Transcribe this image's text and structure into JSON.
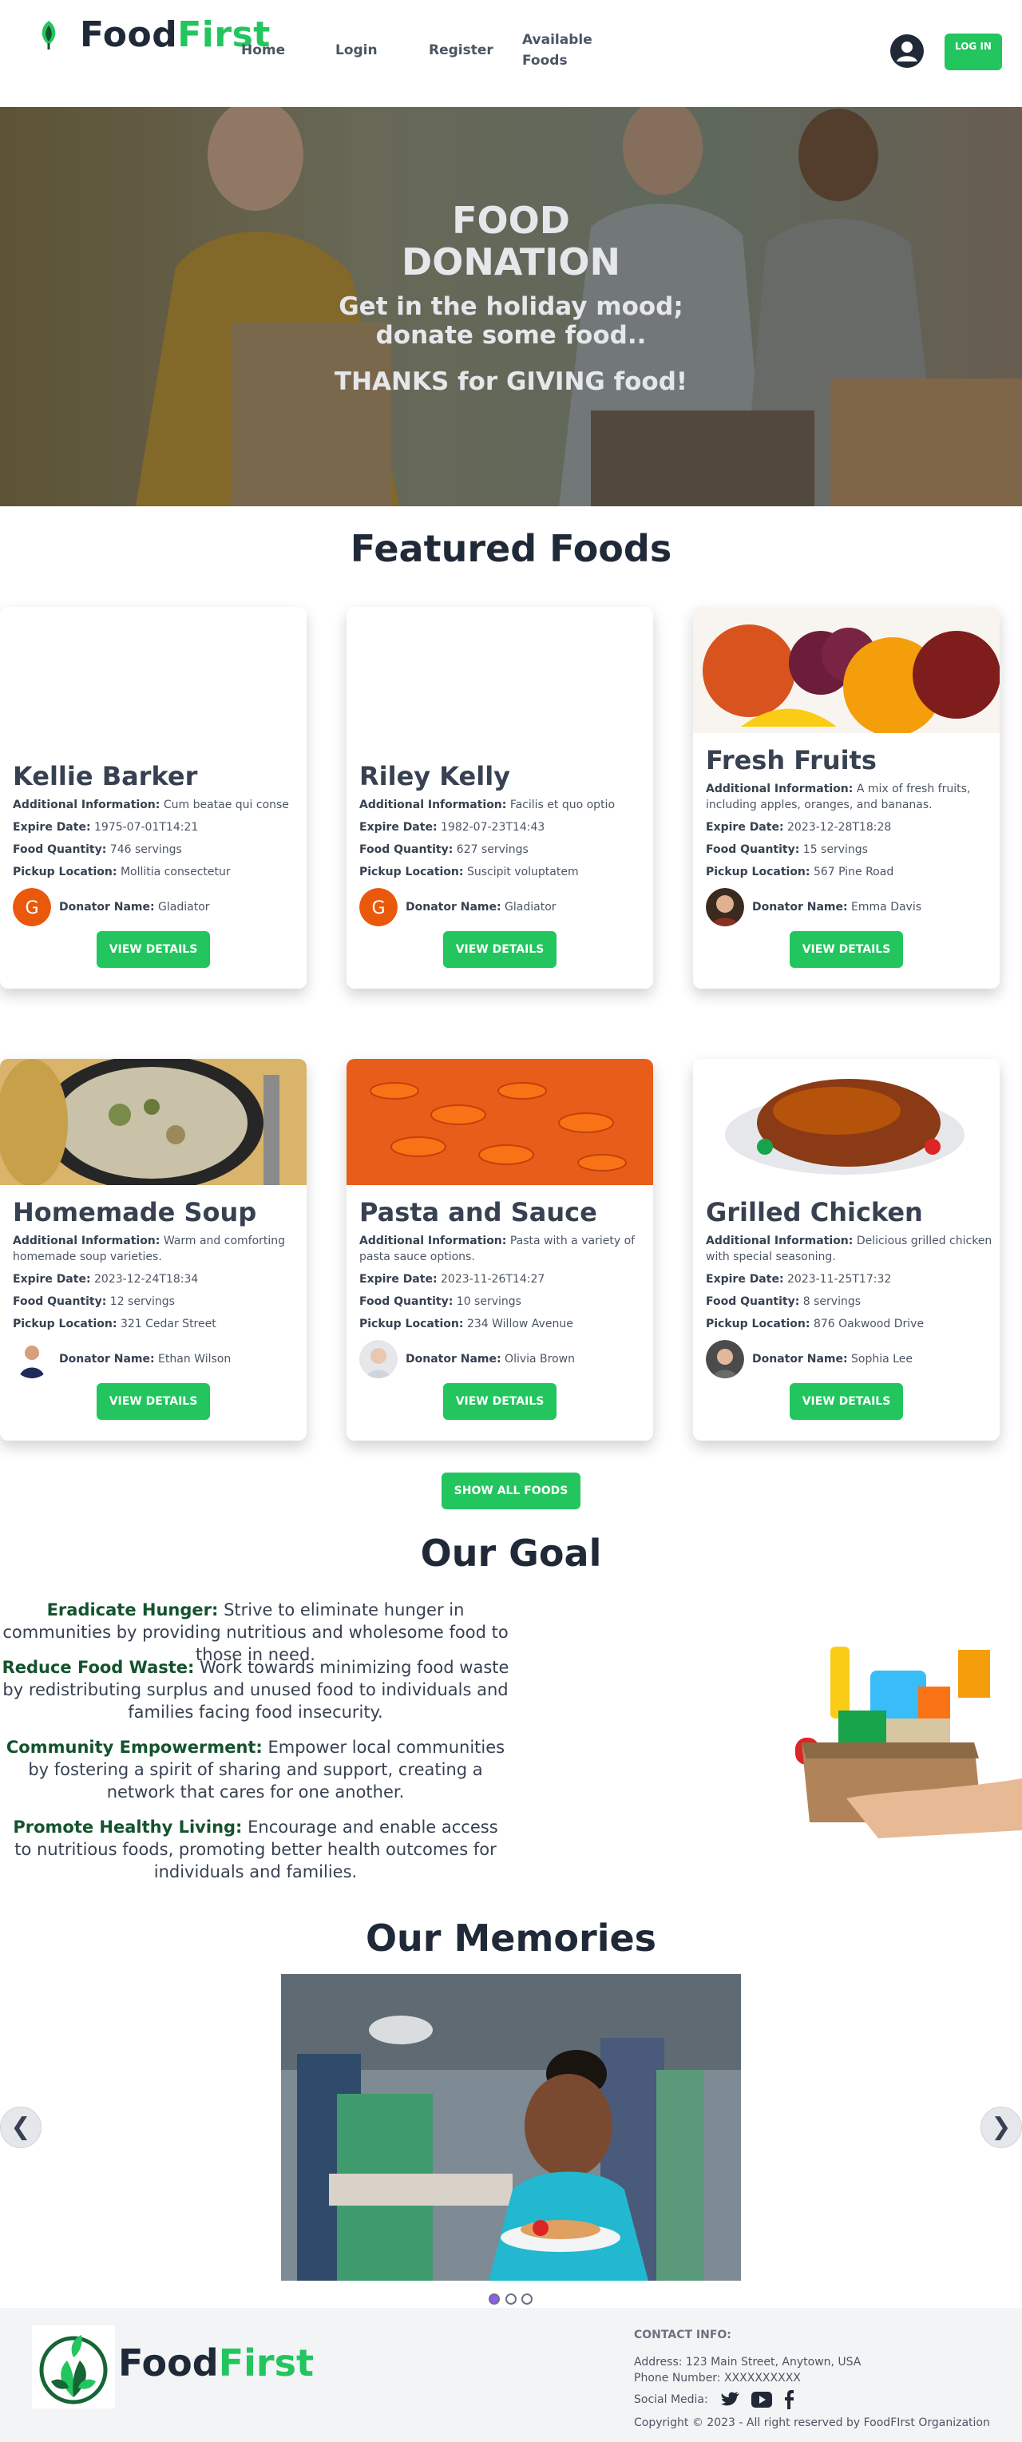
{
  "brand": {
    "name_a": "Food",
    "name_b": "First",
    "accent": "#22c55e"
  },
  "nav": {
    "links": [
      "Home",
      "Login",
      "Register",
      "Available Foods"
    ],
    "login_button": "LOG IN"
  },
  "hero": {
    "title": "FOOD DONATION",
    "subtitle": "Get in the holiday mood; donate some food..",
    "thanks": "THANKS for GIVING food!"
  },
  "featured": {
    "title": "Featured Foods",
    "labels": {
      "info": "Additional Information:",
      "expire": "Expire Date:",
      "quantity": "Food Quantity:",
      "location": "Pickup Location:",
      "donator": "Donator Name:"
    },
    "view_button": "VIEW DETAILS",
    "cards": [
      {
        "name": "Kellie Barker",
        "info": "Cum beatae qui conse",
        "expire": "1975-07-01T14:21",
        "quantity": "746 servings",
        "location": "Mollitia consectetur",
        "donator": "Gladiator",
        "avatar_letter": "G"
      },
      {
        "name": "Riley Kelly",
        "info": "Facilis et quo optio",
        "expire": "1982-07-23T14:43",
        "quantity": "627 servings",
        "location": "Suscipit voluptatem",
        "donator": "Gladiator",
        "avatar_letter": "G"
      },
      {
        "name": "Fresh Fruits",
        "info": "A mix of fresh fruits, including apples, oranges, and bananas.",
        "expire": "2023-12-28T18:28",
        "quantity": "15 servings",
        "location": "567 Pine Road",
        "donator": "Emma Davis"
      },
      {
        "name": "Homemade Soup",
        "info": "Warm and comforting homemade soup varieties.",
        "expire": "2023-12-24T18:34",
        "quantity": "12 servings",
        "location": "321 Cedar Street",
        "donator": "Ethan Wilson"
      },
      {
        "name": "Pasta and Sauce",
        "info": "Pasta with a variety of pasta sauce options.",
        "expire": "2023-11-26T14:27",
        "quantity": "10 servings",
        "location": "234 Willow Avenue",
        "donator": "Olivia Brown"
      },
      {
        "name": "Grilled Chicken",
        "info": "Delicious grilled chicken with special seasoning.",
        "expire": "2023-11-25T17:32",
        "quantity": "8 servings",
        "location": "876 Oakwood Drive",
        "donator": "Sophia Lee"
      }
    ],
    "show_all": "SHOW ALL FOODS"
  },
  "goals": {
    "title": "Our Goal",
    "items": [
      {
        "head": "Eradicate Hunger:",
        "text": " Strive to eliminate hunger in communities by providing nutritious and wholesome food to those in need."
      },
      {
        "head": "Reduce Food Waste:",
        "text": " Work towards minimizing food waste by redistributing surplus and unused food to individuals and families facing food insecurity."
      },
      {
        "head": "Community Empowerment:",
        "text": " Empower local communities by fostering a spirit of sharing and support, creating a network that cares for one another."
      },
      {
        "head": "Promote Healthy Living:",
        "text": " Encourage and enable access to nutritious foods, promoting better health outcomes for individuals and families."
      }
    ]
  },
  "memories": {
    "title": "Our Memories",
    "prev": "❮",
    "next": "❯"
  },
  "footer": {
    "contact_head": "CONTACT INFO:",
    "address": "Address: 123 Main Street, Anytown, USA",
    "phone": "Phone Number: XXXXXXXXXX",
    "social_label": "Social Media:",
    "copyright": "Copyright © 2023 - All right reserved by FoodFIrst Organization"
  }
}
